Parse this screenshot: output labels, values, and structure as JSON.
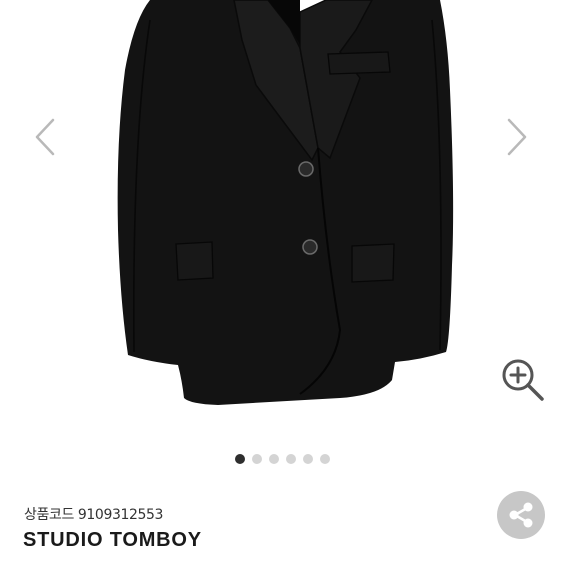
{
  "gallery": {
    "image_alt": "black blazer",
    "slide_count": 6,
    "active_slide": 1
  },
  "product": {
    "code_label": "상품코드",
    "code_value": "9109312553",
    "brand": "STUDIO TOMBOY"
  },
  "colors": {
    "dot_active": "#2e2e2e",
    "dot_inactive": "#d4d4d4",
    "share_bg": "#c7c7c7",
    "jacket": "#121212"
  },
  "icons": [
    "chevron-left-icon",
    "chevron-right-icon",
    "zoom-in-icon",
    "share-icon"
  ]
}
